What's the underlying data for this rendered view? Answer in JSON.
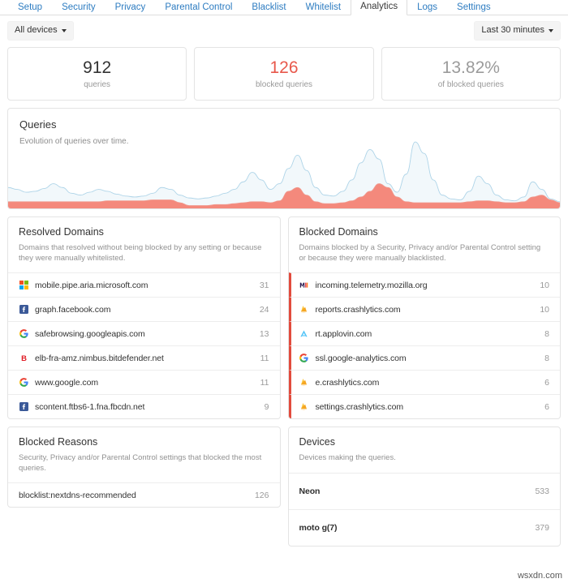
{
  "nav": {
    "tabs": [
      {
        "label": "Setup",
        "active": false
      },
      {
        "label": "Security",
        "active": false
      },
      {
        "label": "Privacy",
        "active": false
      },
      {
        "label": "Parental Control",
        "active": false
      },
      {
        "label": "Blacklist",
        "active": false
      },
      {
        "label": "Whitelist",
        "active": false
      },
      {
        "label": "Analytics",
        "active": true
      },
      {
        "label": "Logs",
        "active": false
      },
      {
        "label": "Settings",
        "active": false
      }
    ]
  },
  "filters": {
    "device_filter": "All devices",
    "time_range": "Last 30 minutes"
  },
  "stats": [
    {
      "value": "912",
      "label": "queries",
      "color": "#333333"
    },
    {
      "value": "126",
      "label": "blocked queries",
      "color": "#e8584b"
    },
    {
      "value": "13.82%",
      "label": "of blocked queries",
      "color": "#9b9b9b"
    }
  ],
  "queries_card": {
    "title": "Queries",
    "description": "Evolution of queries over time."
  },
  "chart_data": {
    "type": "area",
    "title": "Queries",
    "subtitle": "Evolution of queries over time.",
    "xlabel": "",
    "ylabel": "",
    "grid": false,
    "legend": "none",
    "x": [
      0,
      2,
      4,
      6,
      8,
      10,
      12,
      14,
      16,
      18,
      20,
      22,
      24,
      26,
      28,
      30,
      32,
      34,
      36,
      38,
      40,
      42,
      44,
      46,
      48,
      50,
      52,
      54,
      56,
      58,
      60,
      62,
      64,
      66,
      68,
      70,
      72,
      74,
      76,
      78,
      80,
      82,
      84,
      86,
      88,
      90,
      92,
      94,
      96,
      98,
      100
    ],
    "series": [
      {
        "name": "queries",
        "color": "#aed4e8",
        "fill": "#f2f8fb",
        "values": [
          22,
          20,
          17,
          18,
          21,
          26,
          22,
          16,
          14,
          17,
          20,
          18,
          15,
          13,
          12,
          13,
          16,
          22,
          20,
          14,
          11,
          10,
          11,
          13,
          16,
          20,
          28,
          38,
          30,
          20,
          26,
          42,
          56,
          40,
          22,
          14,
          13,
          18,
          30,
          48,
          62,
          52,
          26,
          17,
          36,
          70,
          58,
          30,
          14,
          10,
          9,
          18,
          34,
          26,
          14,
          9,
          8,
          12,
          28,
          20,
          10,
          7
        ]
      },
      {
        "name": "blocked queries",
        "color": "#ef9a8f",
        "fill": "#f4897c",
        "values": [
          7,
          7,
          7,
          7,
          7,
          7,
          7,
          7,
          7,
          7,
          7,
          8,
          8,
          8,
          8,
          8,
          9,
          9,
          9,
          6,
          3,
          3,
          3,
          4,
          4,
          5,
          6,
          7,
          7,
          6,
          8,
          18,
          22,
          14,
          7,
          5,
          5,
          6,
          8,
          12,
          18,
          26,
          22,
          12,
          7,
          6,
          6,
          6,
          6,
          6,
          6,
          7,
          8,
          8,
          7,
          6,
          6,
          7,
          12,
          14,
          9,
          6
        ]
      }
    ]
  },
  "resolved_domains": {
    "title": "Resolved Domains",
    "description": "Domains that resolved without being blocked by any setting or because they were manually whitelisted.",
    "items": [
      {
        "name": "mobile.pipe.aria.microsoft.com",
        "count": "31",
        "icon": "microsoft-icon"
      },
      {
        "name": "graph.facebook.com",
        "count": "24",
        "icon": "facebook-icon"
      },
      {
        "name": "safebrowsing.googleapis.com",
        "count": "13",
        "icon": "google-icon"
      },
      {
        "name": "elb-fra-amz.nimbus.bitdefender.net",
        "count": "11",
        "icon": "bitdefender-icon"
      },
      {
        "name": "www.google.com",
        "count": "11",
        "icon": "google-icon"
      },
      {
        "name": "scontent.ftbs6-1.fna.fbcdn.net",
        "count": "9",
        "icon": "facebook-icon"
      }
    ]
  },
  "blocked_domains": {
    "title": "Blocked Domains",
    "description": "Domains blocked by a Security, Privacy and/or Parental Control setting or because they were manually blacklisted.",
    "accent": "#e24b3d",
    "items": [
      {
        "name": "incoming.telemetry.mozilla.org",
        "count": "10",
        "icon": "mozilla-icon"
      },
      {
        "name": "reports.crashlytics.com",
        "count": "10",
        "icon": "crashlytics-icon"
      },
      {
        "name": "rt.applovin.com",
        "count": "8",
        "icon": "applovin-icon"
      },
      {
        "name": "ssl.google-analytics.com",
        "count": "8",
        "icon": "google-icon"
      },
      {
        "name": "e.crashlytics.com",
        "count": "6",
        "icon": "crashlytics-icon"
      },
      {
        "name": "settings.crashlytics.com",
        "count": "6",
        "icon": "crashlytics-icon"
      }
    ]
  },
  "blocked_reasons": {
    "title": "Blocked Reasons",
    "description": "Security, Privacy and/or Parental Control settings that blocked the most queries.",
    "items": [
      {
        "name": "blocklist:nextdns-recommended",
        "count": "126"
      }
    ]
  },
  "devices": {
    "title": "Devices",
    "description": "Devices making the queries.",
    "items": [
      {
        "name": "Neon",
        "count": "533"
      },
      {
        "name": "moto g(7)",
        "count": "379"
      }
    ]
  },
  "watermark": "wsxdn.com"
}
